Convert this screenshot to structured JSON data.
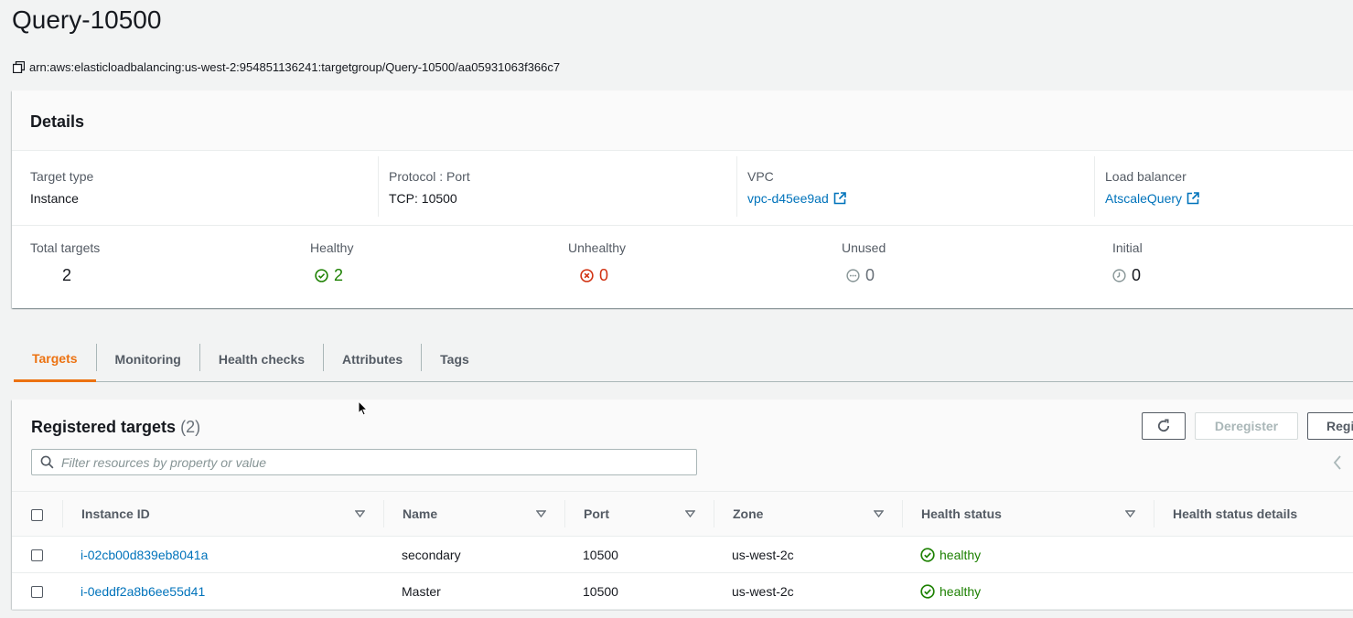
{
  "page": {
    "title": "Query-10500",
    "arn": "arn:aws:elasticloadbalancing:us-west-2:954851136241:targetgroup/Query-10500/aa05931063f366c7"
  },
  "details": {
    "heading": "Details",
    "target_type": {
      "label": "Target type",
      "value": "Instance"
    },
    "protocol_port": {
      "label": "Protocol : Port",
      "value": "TCP: 10500"
    },
    "vpc": {
      "label": "VPC",
      "value": "vpc-d45ee9ad"
    },
    "load_balancer": {
      "label": "Load balancer",
      "value": "AtscaleQuery"
    },
    "counts": {
      "total": {
        "label": "Total targets",
        "value": "2"
      },
      "healthy": {
        "label": "Healthy",
        "value": "2"
      },
      "unhealthy": {
        "label": "Unhealthy",
        "value": "0"
      },
      "unused": {
        "label": "Unused",
        "value": "0"
      },
      "initial": {
        "label": "Initial",
        "value": "0"
      }
    }
  },
  "tabs": [
    {
      "label": "Targets",
      "active": true
    },
    {
      "label": "Monitoring"
    },
    {
      "label": "Health checks"
    },
    {
      "label": "Attributes"
    },
    {
      "label": "Tags"
    }
  ],
  "registered": {
    "title": "Registered targets",
    "count": "(2)",
    "deregister_label": "Deregister",
    "register_label": "Regi",
    "filter_placeholder": "Filter resources by property or value",
    "columns": [
      "Instance ID",
      "Name",
      "Port",
      "Zone",
      "Health status",
      "Health status details"
    ],
    "rows": [
      {
        "instance_id": "i-02cb00d839eb8041a",
        "name": "secondary",
        "port": "10500",
        "zone": "us-west-2c",
        "health": "healthy",
        "details": ""
      },
      {
        "instance_id": "i-0eddf2a8b6ee55d41",
        "name": "Master",
        "port": "10500",
        "zone": "us-west-2c",
        "health": "healthy",
        "details": ""
      }
    ]
  },
  "colors": {
    "link": "#0073bb",
    "healthy": "#1d8102",
    "unhealthy": "#d13212",
    "active_tab": "#ec7211"
  },
  "icons": [
    "copy-icon",
    "external-link-icon",
    "check-circle-icon",
    "x-circle-icon",
    "dots-circle-icon",
    "clock-icon",
    "refresh-icon",
    "search-icon",
    "sort-icon",
    "chevron-left-icon"
  ]
}
